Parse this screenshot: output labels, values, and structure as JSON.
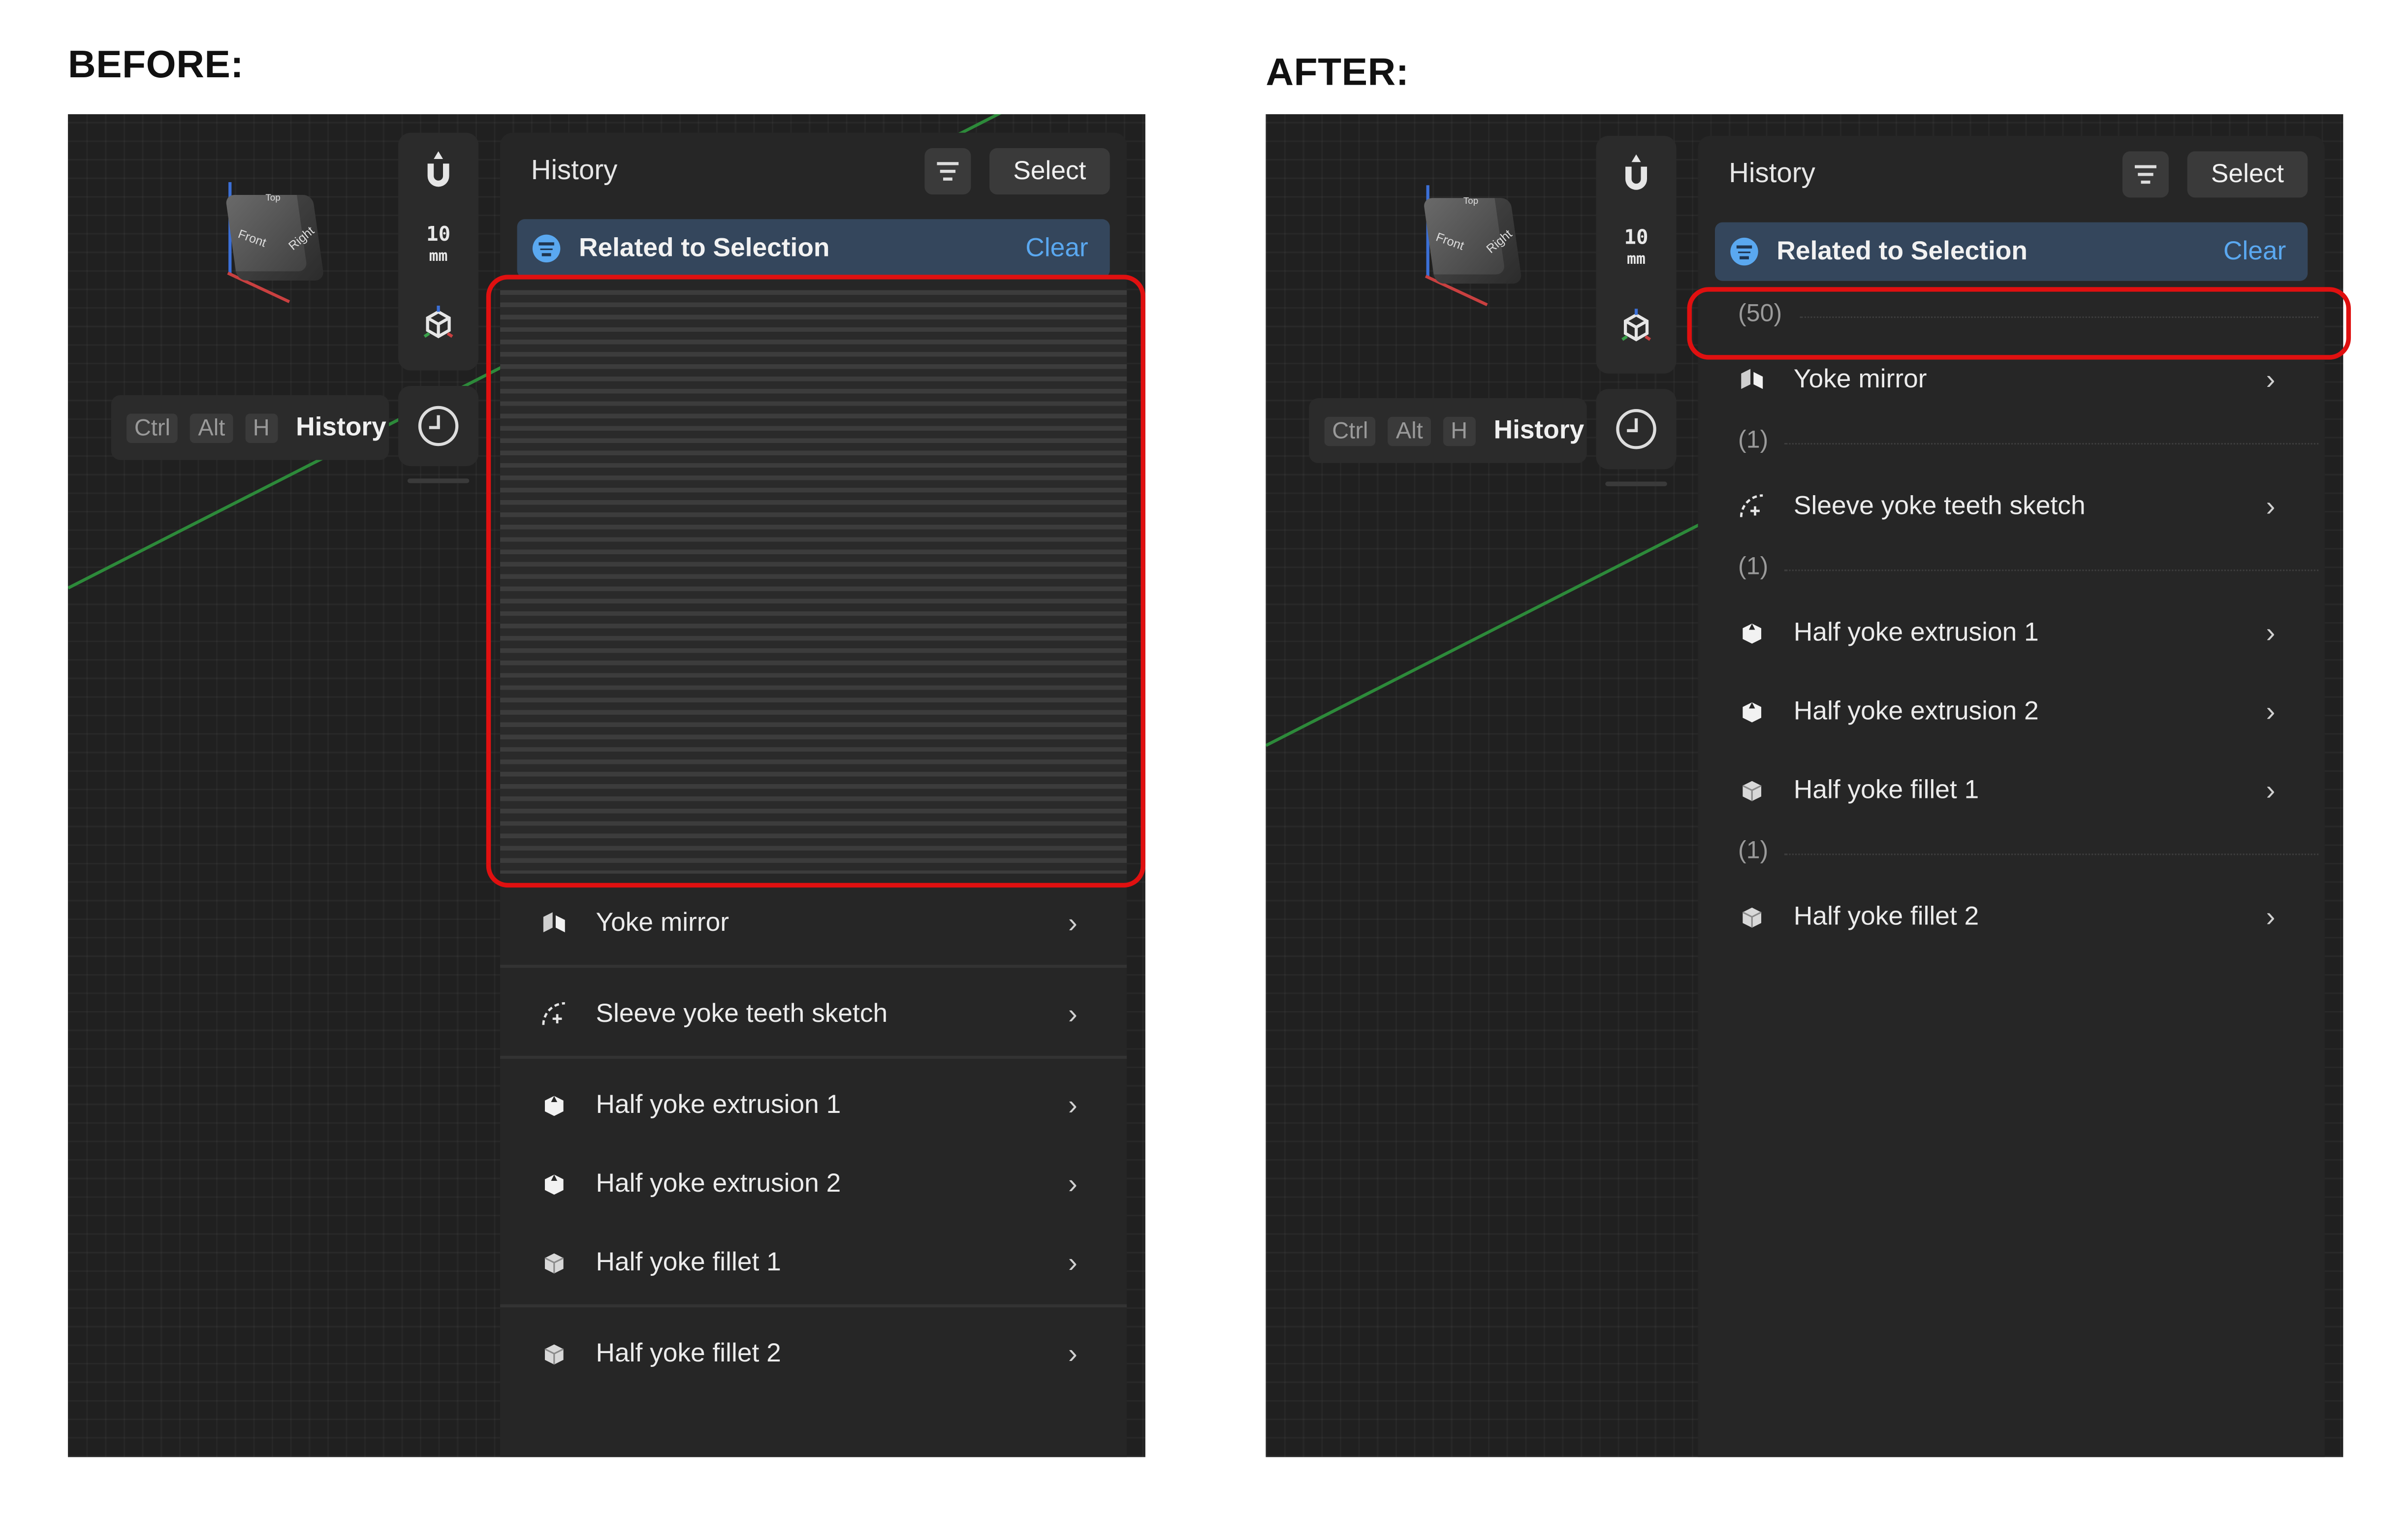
{
  "before": {
    "heading": "BEFORE:",
    "toolbar": {
      "snap_value": "10",
      "snap_unit": "mm"
    },
    "shortcut": {
      "keys": [
        "Ctrl",
        "Alt",
        "H"
      ],
      "label": "History"
    },
    "panel": {
      "title": "History",
      "select_label": "Select",
      "related": {
        "label": "Related to Selection",
        "clear_label": "Clear"
      },
      "items": [
        {
          "label": "Yoke mirror",
          "icon": "mirror-icon"
        },
        {
          "label": "Sleeve yoke teeth sketch",
          "icon": "sketch-icon"
        },
        {
          "label": "Half yoke extrusion 1",
          "icon": "extrusion-icon"
        },
        {
          "label": "Half yoke extrusion 2",
          "icon": "extrusion-icon"
        },
        {
          "label": "Half yoke fillet 1",
          "icon": "fillet-icon"
        },
        {
          "label": "Half yoke fillet 2",
          "icon": "fillet-icon"
        }
      ]
    },
    "navcube": {
      "front": "Front",
      "right": "Right",
      "top": "Top"
    }
  },
  "after": {
    "heading": "AFTER:",
    "toolbar": {
      "snap_value": "10",
      "snap_unit": "mm"
    },
    "shortcut": {
      "keys": [
        "Ctrl",
        "Alt",
        "H"
      ],
      "label": "History"
    },
    "panel": {
      "title": "History",
      "select_label": "Select",
      "related": {
        "label": "Related to Selection",
        "clear_label": "Clear"
      },
      "counts": [
        "(50)",
        "(1)",
        "(1)",
        "(1)"
      ],
      "items": [
        {
          "label": "Yoke mirror",
          "icon": "mirror-icon"
        },
        {
          "label": "Sleeve yoke teeth sketch",
          "icon": "sketch-icon"
        },
        {
          "label": "Half yoke extrusion 1",
          "icon": "extrusion-icon"
        },
        {
          "label": "Half yoke extrusion 2",
          "icon": "extrusion-icon"
        },
        {
          "label": "Half yoke fillet 1",
          "icon": "fillet-icon"
        },
        {
          "label": "Half yoke fillet 2",
          "icon": "fillet-icon"
        }
      ]
    },
    "navcube": {
      "front": "Front",
      "right": "Right",
      "top": "Top"
    }
  },
  "colors": {
    "highlight": "#e01010",
    "accent": "#5aa8f0",
    "panel": "#262626",
    "viewport": "#202020"
  }
}
